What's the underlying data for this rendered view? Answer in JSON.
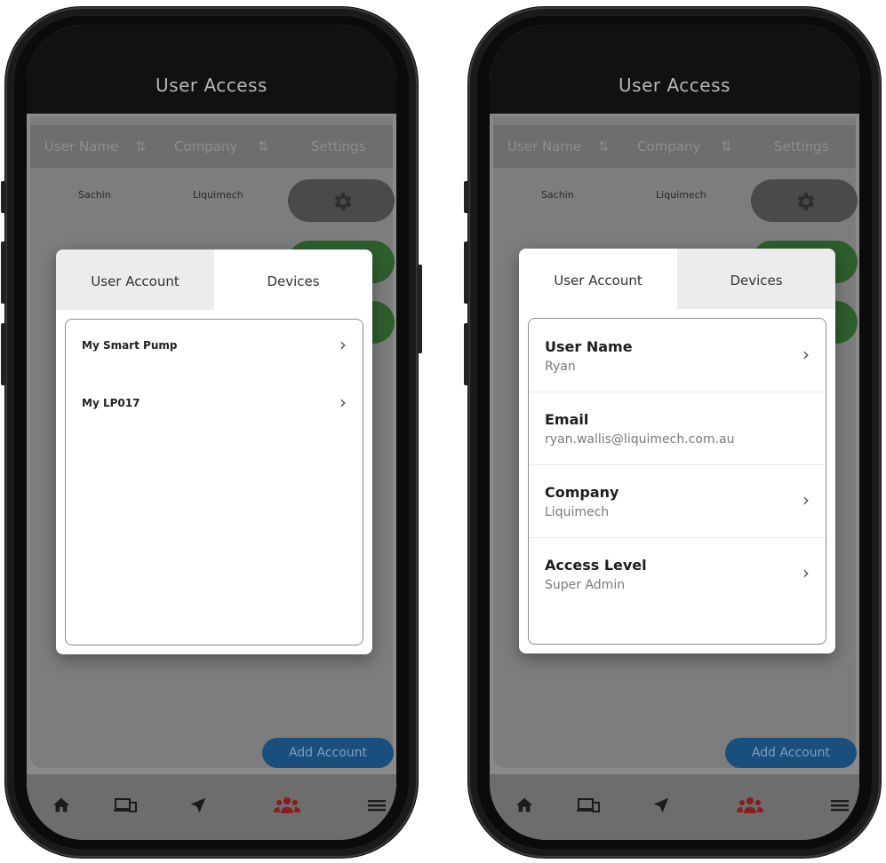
{
  "header": {
    "title": "User Access"
  },
  "columns": {
    "user_name": "User Name",
    "company": "Company",
    "settings": "Settings"
  },
  "row": {
    "name": "Sachin",
    "company": "Liquimech"
  },
  "add_button": "Add Account",
  "tabs": {
    "user_account": "User Account",
    "devices": "Devices"
  },
  "devices": [
    {
      "label": "My Smart Pump"
    },
    {
      "label": "My LP017"
    }
  ],
  "account_fields": [
    {
      "label": "User Name",
      "value": "Ryan"
    },
    {
      "label": "Email",
      "value": "ryan.wallis@liquimech.com.au"
    },
    {
      "label": "Company",
      "value": "Liquimech"
    },
    {
      "label": "Access Level",
      "value": "Super Admin"
    }
  ],
  "colors": {
    "accent_blue": "#1a4f7d",
    "green": "#2f5e2d",
    "nav_active": "#e02424"
  },
  "nav_icons": [
    "home-icon",
    "devices-icon",
    "location-arrow-icon",
    "users-icon",
    "menu-icon"
  ],
  "sort_glyph": "⇅",
  "chevron_glyph": "›"
}
